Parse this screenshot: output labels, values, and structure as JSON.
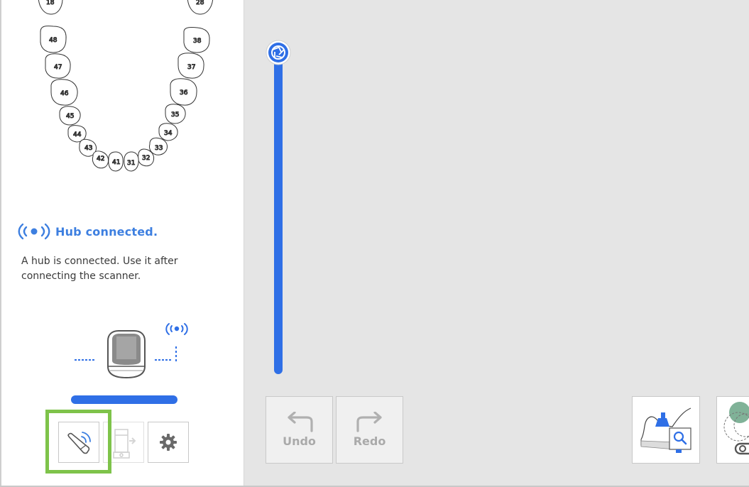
{
  "teeth": {
    "upper_partial": [
      "18",
      "28"
    ],
    "right_side": [
      "48",
      "47",
      "46",
      "45",
      "44",
      "43",
      "42",
      "41"
    ],
    "left_side": [
      "38",
      "37",
      "36",
      "35",
      "34",
      "33",
      "32",
      "31"
    ]
  },
  "hub": {
    "status": "Hub connected.",
    "description": "A hub is connected. Use it after connecting the scanner.",
    "progress": 1.0
  },
  "toolbar": {
    "scanner_icon": "scanner-wireless-icon",
    "hub_icon": "hub-transfer-icon",
    "settings_icon": "gear-icon",
    "selected": "scanner"
  },
  "actions": {
    "undo": "Undo",
    "redo": "Redo"
  },
  "colors": {
    "accent": "#3d7fe0",
    "bar": "#2f6fe6",
    "highlight": "#7ec34a",
    "disabled_text": "#aaaaaa"
  }
}
